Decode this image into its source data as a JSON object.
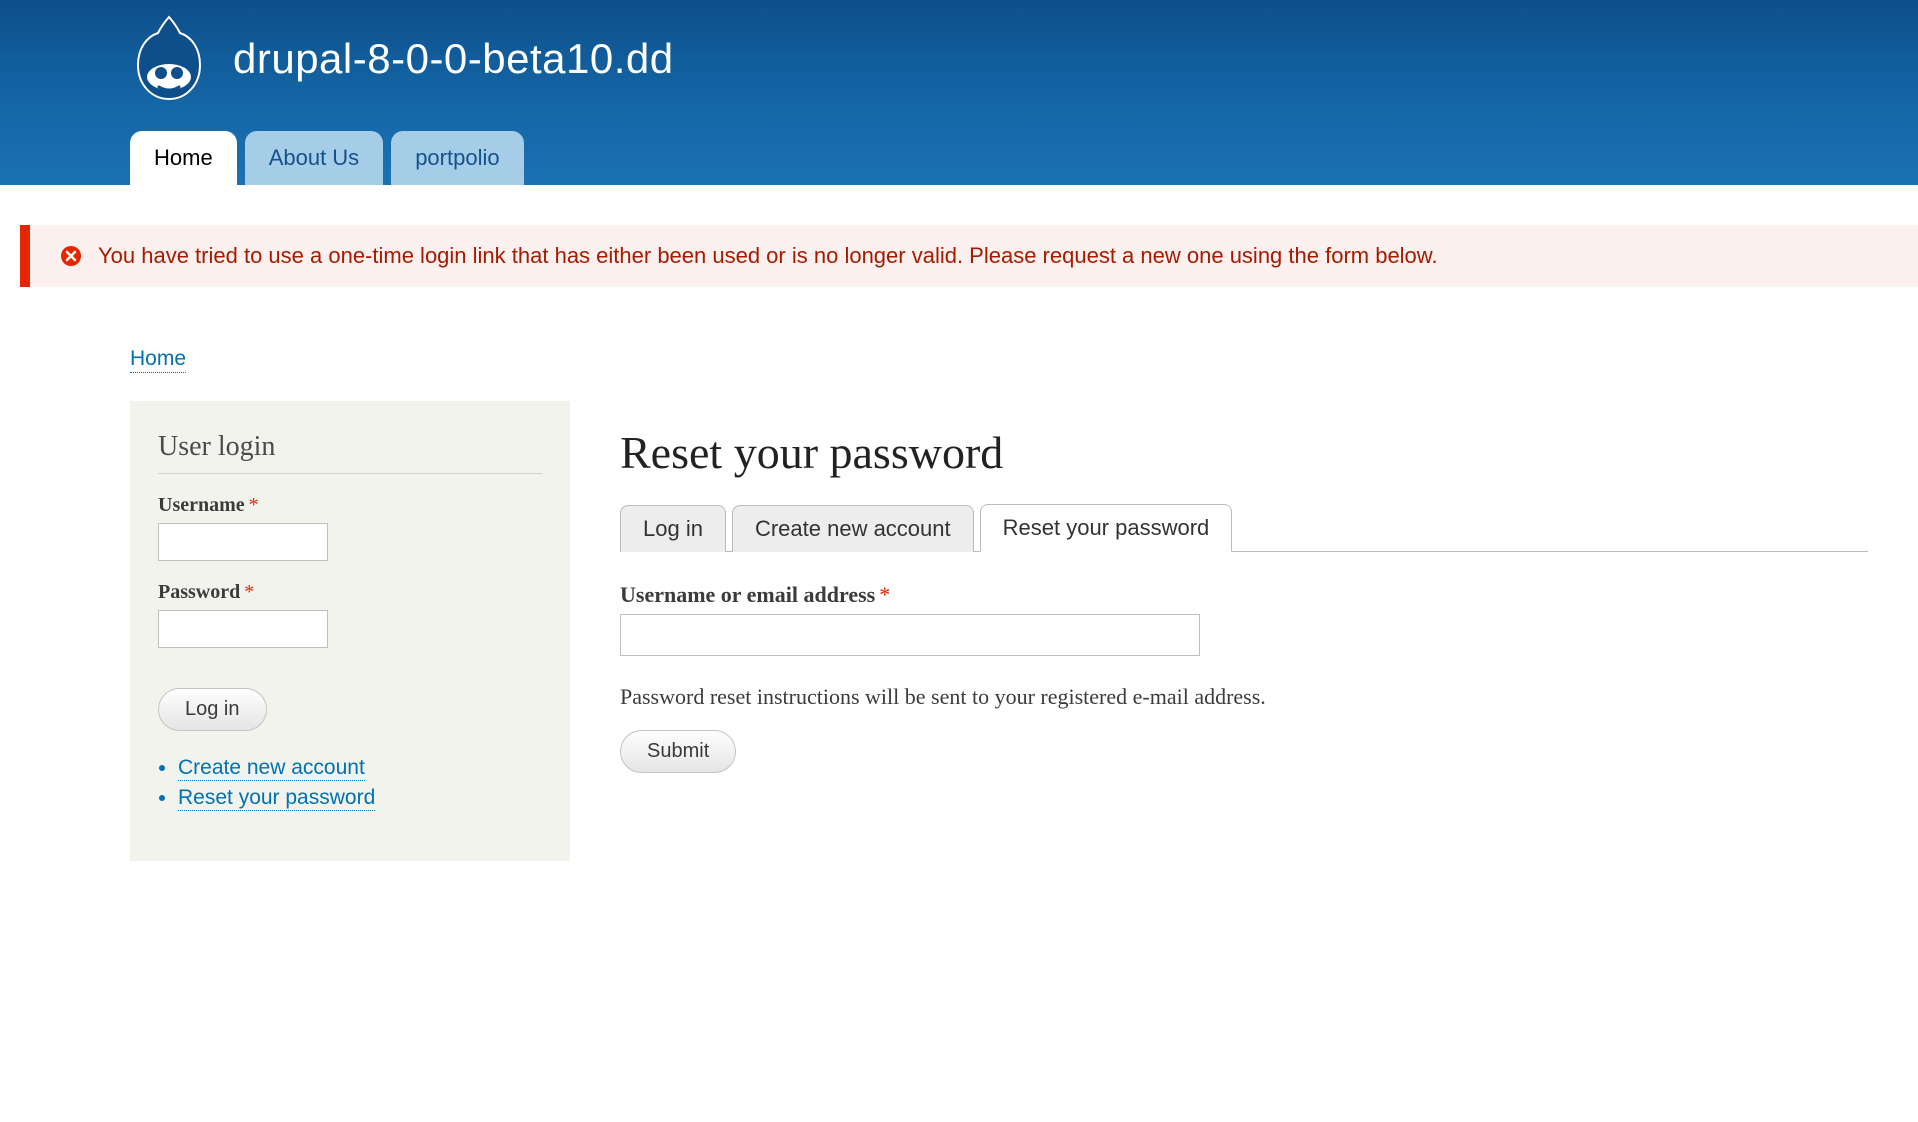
{
  "header": {
    "site_name": "drupal-8-0-0-beta10.dd",
    "nav": [
      {
        "label": "Home",
        "active": true
      },
      {
        "label": "About Us",
        "active": false
      },
      {
        "label": "portpolio",
        "active": false
      }
    ]
  },
  "message": {
    "text": "You have tried to use a one-time login link that has either been used or is no longer valid. Please request a new one using the form below."
  },
  "breadcrumb": {
    "home": "Home"
  },
  "sidebar": {
    "title": "User login",
    "username_label": "Username",
    "password_label": "Password",
    "login_button": "Log in",
    "links": [
      "Create new account",
      "Reset your password"
    ]
  },
  "main": {
    "title": "Reset your password",
    "tabs": [
      {
        "label": "Log in",
        "active": false
      },
      {
        "label": "Create new account",
        "active": false
      },
      {
        "label": "Reset your password",
        "active": true
      }
    ],
    "field_label": "Username or email address",
    "help_text": "Password reset instructions will be sent to your registered e-mail address.",
    "submit_button": "Submit"
  },
  "required_mark": "*"
}
